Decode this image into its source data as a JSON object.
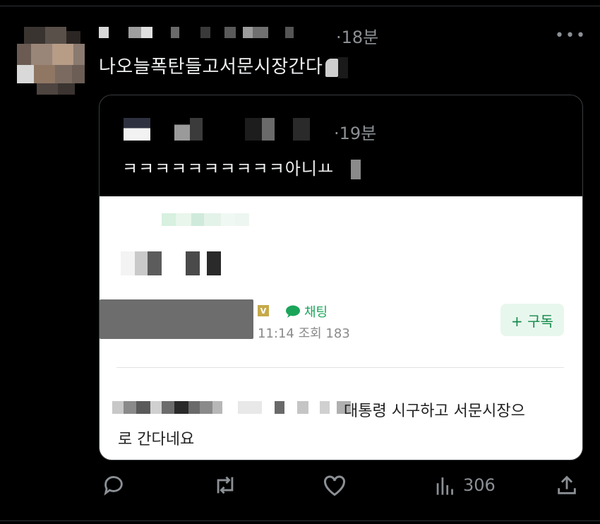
{
  "post": {
    "time": "·18분",
    "text": "나오늘폭탄들고서문시장간다"
  },
  "quoted": {
    "time": "·19분",
    "text": "ㅋㅋㅋㅋㅋㅋㅋㅋㅋㅋ아니ㅛ"
  },
  "card": {
    "chat_label": "채팅",
    "v_badge": "V",
    "meta": "11:14 조회 183",
    "subscribe_label": "+ 구독",
    "body_line1": "대통령 시구하고 서문시장으",
    "body_line2": "로 간다네요"
  },
  "actions": {
    "views": "306"
  }
}
